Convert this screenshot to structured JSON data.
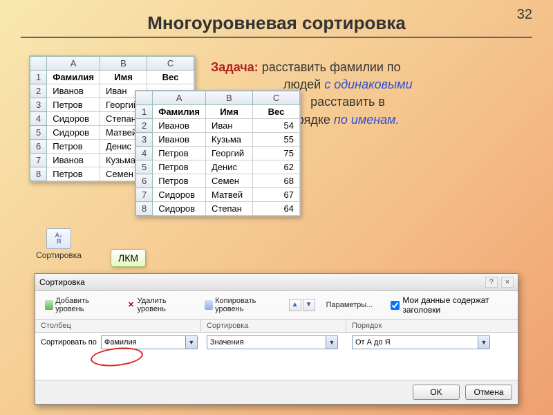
{
  "page_number": "32",
  "title": "Многоуровневая сортировка",
  "task": {
    "label": "Задача:",
    "text1": "расставить фамилии по",
    "text2": "людей",
    "blue1": "с одинаковыми",
    "text3": "расставить в",
    "text4": "порядке",
    "blue2": "по именам."
  },
  "grids": {
    "cols": [
      "A",
      "B",
      "C"
    ],
    "headers": [
      "Фамилия",
      "Имя",
      "Вес"
    ],
    "unsorted_rows": [
      {
        "r": "2",
        "a": "Иванов",
        "b": "Иван",
        "c": ""
      },
      {
        "r": "3",
        "a": "Петров",
        "b": "Георгий",
        "c": ""
      },
      {
        "r": "4",
        "a": "Сидоров",
        "b": "Степан",
        "c": ""
      },
      {
        "r": "5",
        "a": "Сидоров",
        "b": "Матвей",
        "c": ""
      },
      {
        "r": "6",
        "a": "Петров",
        "b": "Денис",
        "c": ""
      },
      {
        "r": "7",
        "a": "Иванов",
        "b": "Кузьма",
        "c": ""
      },
      {
        "r": "8",
        "a": "Петров",
        "b": "Семен",
        "c": ""
      }
    ],
    "sorted_rows": [
      {
        "r": "2",
        "a": "Иванов",
        "b": "Иван",
        "c": "54"
      },
      {
        "r": "3",
        "a": "Иванов",
        "b": "Кузьма",
        "c": "55"
      },
      {
        "r": "4",
        "a": "Петров",
        "b": "Георгий",
        "c": "75"
      },
      {
        "r": "5",
        "a": "Петров",
        "b": "Денис",
        "c": "62"
      },
      {
        "r": "6",
        "a": "Петров",
        "b": "Семен",
        "c": "68"
      },
      {
        "r": "7",
        "a": "Сидоров",
        "b": "Матвей",
        "c": "67"
      },
      {
        "r": "8",
        "a": "Сидоров",
        "b": "Степан",
        "c": "64"
      }
    ]
  },
  "ribbon_sort_label": "Сортировка",
  "lkm": "ЛКМ",
  "dialog": {
    "title": "Сортировка",
    "add_level": "Добавить уровень",
    "del_level": "Удалить уровень",
    "copy_level": "Копировать уровень",
    "params": "Параметры...",
    "headers_chk": "Мои данные содержат заголовки",
    "col_header": "Столбец",
    "sort_header": "Сортировка",
    "order_header": "Порядок",
    "sort_by_label": "Сортировать по",
    "sort_by_value": "Фамилия",
    "sort_on_value": "Значения",
    "order_value": "От А до Я",
    "ok": "OK",
    "cancel": "Отмена"
  }
}
